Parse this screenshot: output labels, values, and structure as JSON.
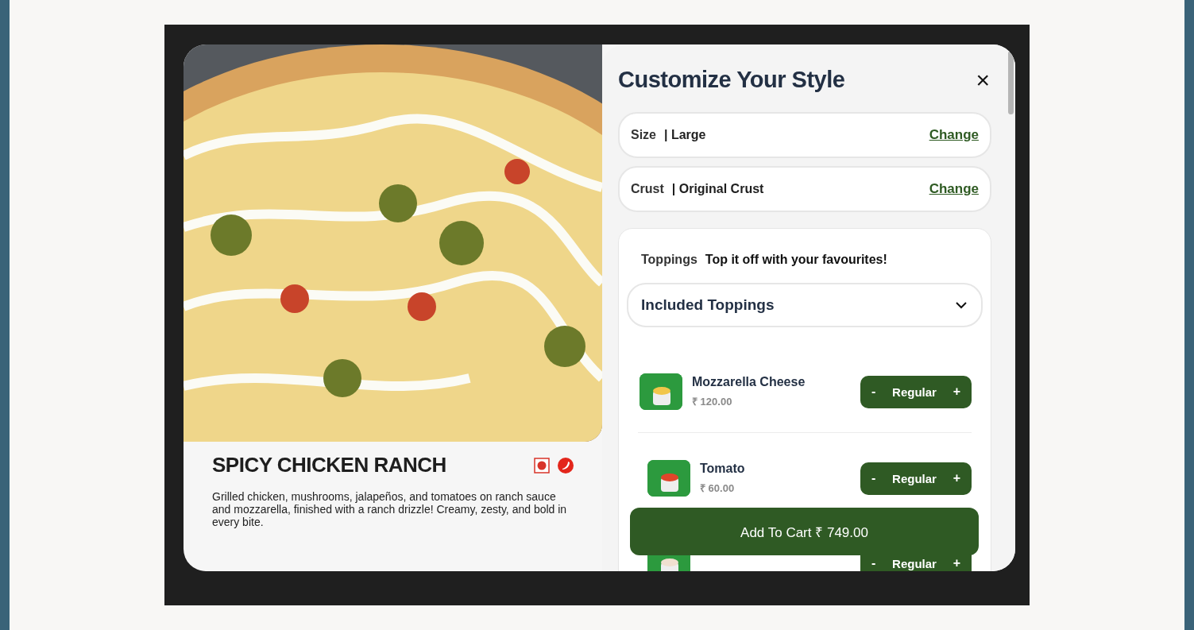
{
  "product": {
    "name": "SPICY CHICKEN RANCH",
    "description": "Grilled chicken, mushrooms, jalapeños, and tomatoes on ranch sauce and mozzarella, finished with a ranch drizzle! Creamy, zesty, and bold in every bite."
  },
  "panel": {
    "title": "Customize Your Style",
    "close": "×"
  },
  "options": [
    {
      "label": "Size",
      "value": "| Large",
      "action": "Change"
    },
    {
      "label": "Crust",
      "value": "| Original Crust",
      "action": "Change"
    }
  ],
  "toppings": {
    "label": "Toppings",
    "tagline": "Top it off with your favourites!",
    "dropdown": "Included Toppings",
    "expanded": true,
    "items": [
      {
        "name": "Mozzarella Cheese",
        "price": "₹ 120.00",
        "portion": "Regular",
        "minus": "-",
        "plus": "+",
        "kind": "cheese"
      },
      {
        "name": "Tomato",
        "price": "₹ 60.00",
        "portion": "Regular",
        "minus": "-",
        "plus": "+",
        "kind": "tomato"
      },
      {
        "portion": "Regular",
        "minus": "-",
        "plus": "+",
        "kind": "chicken"
      }
    ]
  },
  "cart_button": "Add To Cart ₹ 749.00"
}
